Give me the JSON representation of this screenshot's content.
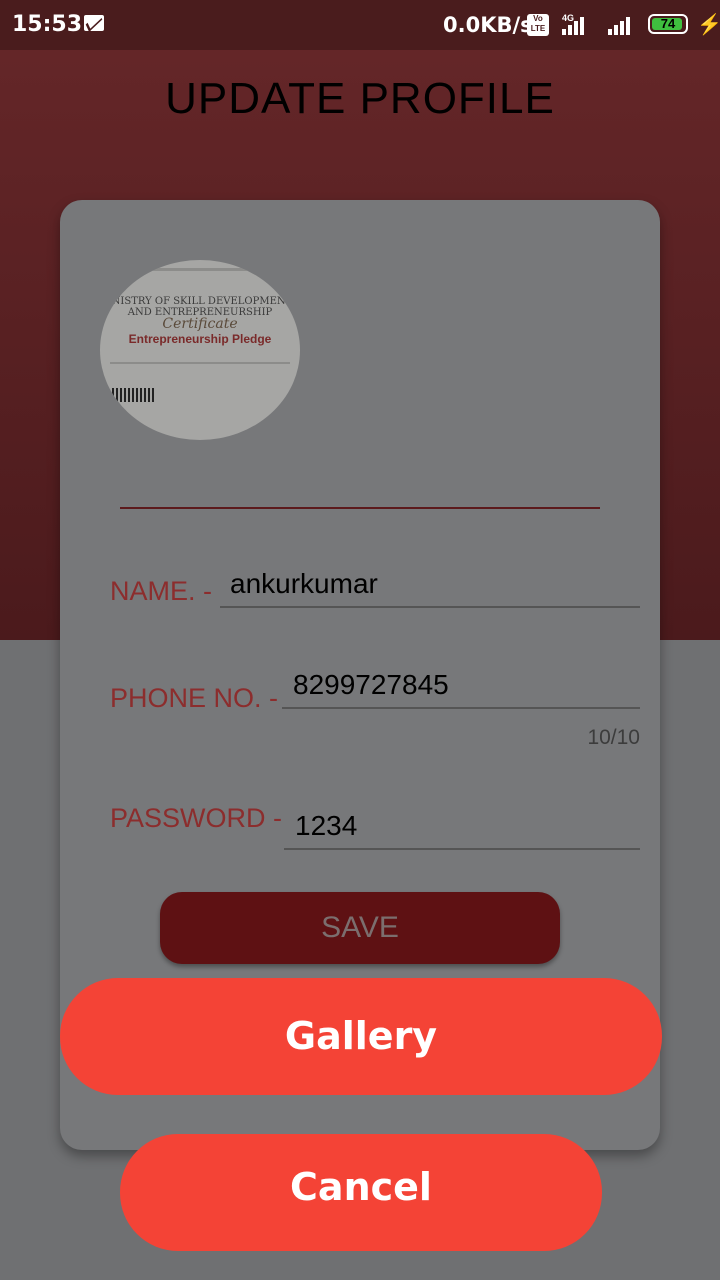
{
  "status_bar": {
    "time": "15:53",
    "network_speed": "0.0KB/s",
    "volte_label": "Vo LTE",
    "network_type": "4G",
    "battery_level": "74",
    "icons": [
      "mail-icon",
      "volte-icon",
      "signal-icon",
      "battery-icon",
      "charging-bolt-icon"
    ]
  },
  "page": {
    "title": "UPDATE PROFILE"
  },
  "form": {
    "name_label": "NAME. -",
    "name_value": "ankurkumar",
    "phone_label": "PHONE NO. -",
    "phone_value": "8299727845",
    "phone_counter": "10/10",
    "password_label": "PASSWORD -",
    "password_value": "1234",
    "save_label": "SAVE"
  },
  "certificate": {
    "heading": "INISTRY OF SKILL DEVELOPMENT AND ENTREPRENEURSHIP",
    "title": "Certificate",
    "subtitle": "Entrepreneurship Pledge"
  },
  "image_picker": {
    "gallery_label": "Gallery",
    "cancel_label": "Cancel"
  },
  "colors": {
    "header": "#642628",
    "accent_red": "#f44336",
    "save_button": "#5e1113",
    "label_red": "#8c2d2d"
  }
}
